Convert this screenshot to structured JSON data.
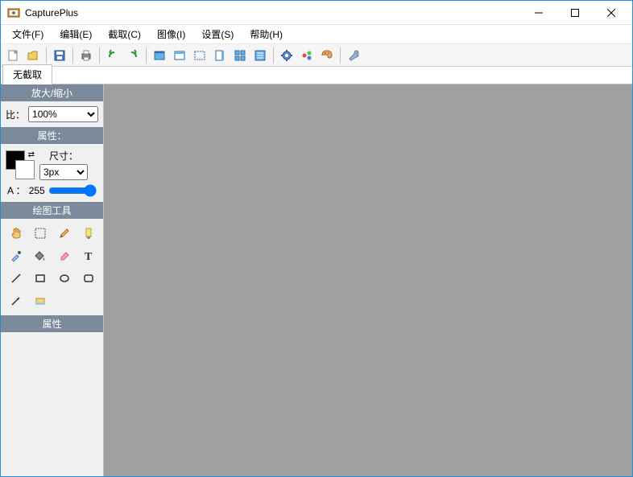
{
  "app": {
    "title": "CapturePlus"
  },
  "menu": {
    "file": "文件(F)",
    "edit": "编辑(E)",
    "capture": "截取(C)",
    "image": "图像(I)",
    "settings": "设置(S)",
    "help": "帮助(H)"
  },
  "tabs": {
    "no_capture": "无截取"
  },
  "sidebar": {
    "zoom_header": "放大/缩小",
    "zoom_label": "比：",
    "zoom_value": "100%",
    "props_header": "属性：",
    "size_label": "尺寸：",
    "size_value": "3px",
    "alpha_label": "A ：",
    "alpha_value": "255",
    "drawtools_header": "绘图工具",
    "props2_header": "属性"
  },
  "colors": {
    "fg": "#000000",
    "bg": "#ffffff"
  }
}
